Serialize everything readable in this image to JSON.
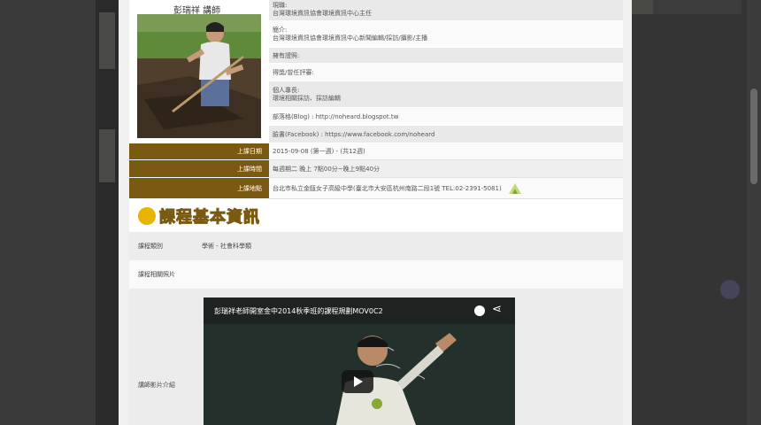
{
  "teacher": {
    "name": "彭瑞祥 講師",
    "title_label": "現職:",
    "title_value": "台灣環境資訊協會環境資訊中心主任",
    "intro_label": "簡介:",
    "intro_value": "台灣環境資訊協會環境資訊中心新聞編輯/採訪/攝影/主播",
    "license_label": "擁有證照:",
    "honors_label": "得獎/曾任評審:",
    "expertise_label": "個人專長:",
    "expertise_value": "環境相關採訪、採訪編輯",
    "blog_label": "部落格(Blog) : http://noheard.blogspot.tw",
    "facebook_label": "臉書(Facebook) : https://www.facebook.com/noheard"
  },
  "schedule": {
    "start_date_label": "上課日期",
    "start_date_value": "2015-09-08 (第一週) - (共12週)",
    "time_label": "上課時間",
    "time_value": "每週期二 晚上 7點00分~晚上9點40分",
    "location_label": "上課地點",
    "location_value": "台北市私立金甌女子高級中學(臺北市大安區杭州南路二段1號 TEL:02-2391-5081)"
  },
  "section_title": "課程基本資訊",
  "course": {
    "category_label": "課程類別",
    "category_value": "學術 - 社會科學類",
    "photo_label": "課程相關照片",
    "video_label": "講師影片介紹",
    "video_title": "彭瑞祥老師開室金中2014秋季班的課程規劃MOV0C2"
  },
  "colors": {
    "label_bg": "#7a5a12",
    "accent": "#e8b400"
  }
}
